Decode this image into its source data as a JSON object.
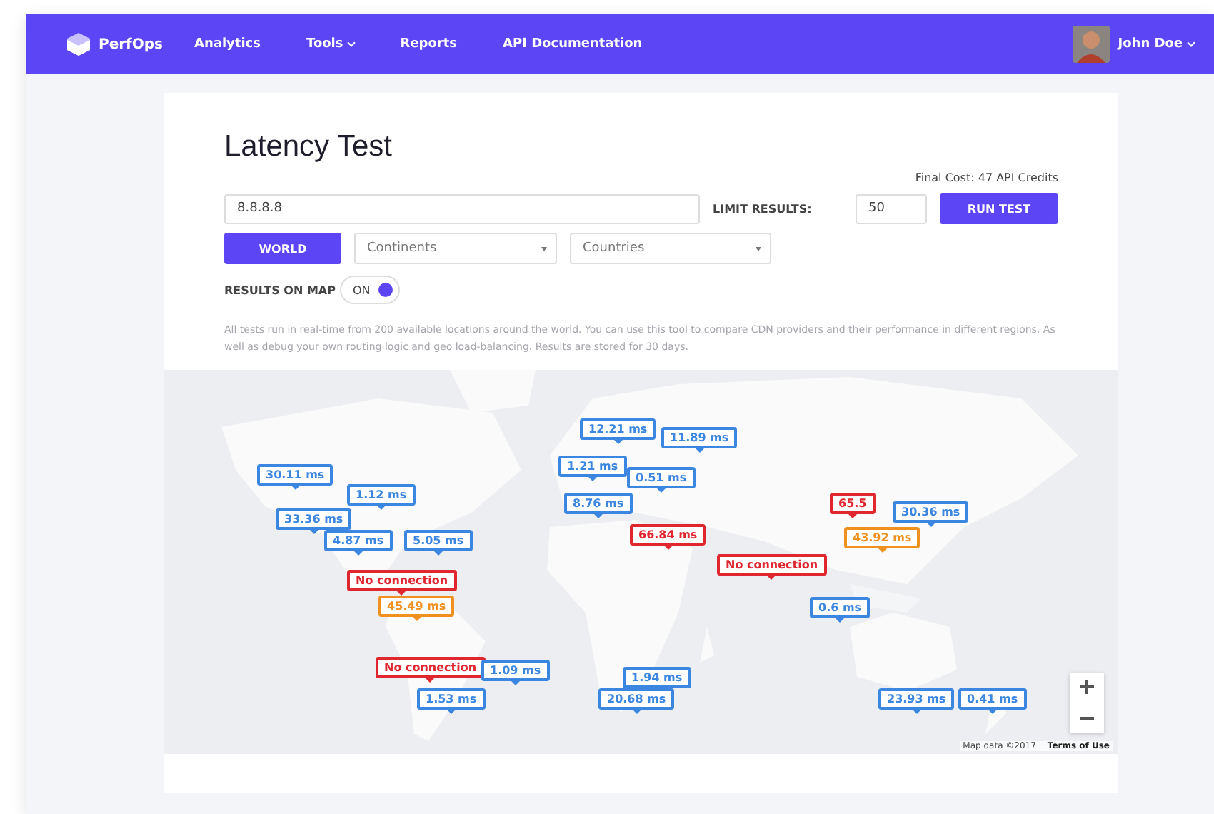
{
  "nav": {
    "brand": "PerfOps",
    "links": [
      {
        "label": "Analytics",
        "dropdown": false
      },
      {
        "label": "Tools",
        "dropdown": true
      },
      {
        "label": "Reports",
        "dropdown": false
      },
      {
        "label": "API Documentation",
        "dropdown": false
      }
    ],
    "user": {
      "name": "John Doe",
      "dropdown": true
    }
  },
  "page": {
    "title": "Latency Test",
    "cost": "Final Cost: 47 API Credits",
    "target": {
      "value": "8.8.8.8"
    },
    "limit_label": "LIMIT RESULTS:",
    "limit": {
      "value": "50"
    },
    "run_button": "RUN TEST",
    "scope_button": "WORLD",
    "continents": {
      "placeholder": "Continents"
    },
    "countries": {
      "placeholder": "Countries"
    },
    "map_toggle": {
      "label": "RESULTS ON MAP",
      "state_label": "ON",
      "on": true
    },
    "description": "All tests run in real-time from 200 available locations around the world. You can use this tool to compare CDN providers and their performance in different regions. As well as debug your own routing logic and geo load-balancing. Results are stored for 30 days."
  },
  "map": {
    "markers": [
      {
        "text": "30.11 ms",
        "color": "#3a86e0"
      },
      {
        "text": "33.36 ms",
        "color": "#3a86e0"
      },
      {
        "text": "1.12 ms",
        "color": "#3a86e0"
      },
      {
        "text": "4.87 ms",
        "color": "#3a86e0"
      },
      {
        "text": "5.05 ms",
        "color": "#3a86e0"
      },
      {
        "text": "12.21 ms",
        "color": "#3a86e0"
      },
      {
        "text": "11.89 ms",
        "color": "#3a86e0"
      },
      {
        "text": "1.21 ms",
        "color": "#3a86e0"
      },
      {
        "text": "0.51 ms",
        "color": "#3a86e0"
      },
      {
        "text": "8.76 ms",
        "color": "#3a86e0"
      },
      {
        "text": "66.84 ms",
        "color": "#e0262e"
      },
      {
        "text": "No connection",
        "color": "#e0262e"
      },
      {
        "text": "65.5",
        "color": "#e0262e"
      },
      {
        "text": "30.36 ms",
        "color": "#3a86e0"
      },
      {
        "text": "43.92 ms",
        "color": "#f0901e"
      },
      {
        "text": "No connection",
        "color": "#e0262e"
      },
      {
        "text": "45.49 ms",
        "color": "#f0901e"
      },
      {
        "text": "0.6 ms",
        "color": "#3a86e0"
      },
      {
        "text": "No connection",
        "color": "#e0262e"
      },
      {
        "text": "1.09 ms",
        "color": "#3a86e0"
      },
      {
        "text": "1.53 ms",
        "color": "#3a86e0"
      },
      {
        "text": "1.94 ms",
        "color": "#3a86e0"
      },
      {
        "text": "20.68 ms",
        "color": "#3a86e0"
      },
      {
        "text": "23.93 ms",
        "color": "#3a86e0"
      },
      {
        "text": "0.41 ms",
        "color": "#3a86e0"
      }
    ],
    "attribution": "Map data ©2017",
    "terms": "Terms of Use"
  }
}
